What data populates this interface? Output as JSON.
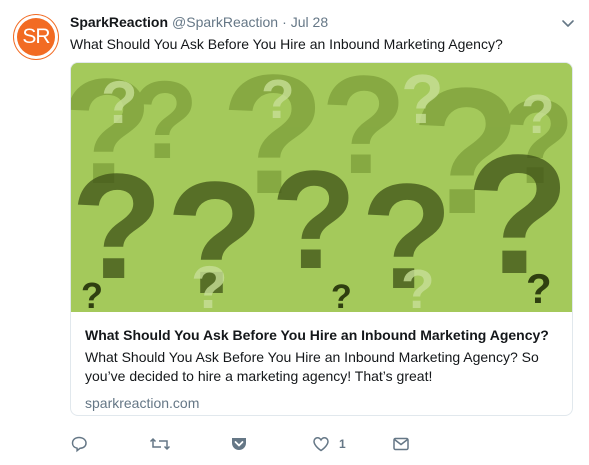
{
  "avatar": {
    "initials": "SR",
    "color": "#f26b23"
  },
  "author": {
    "name": "SparkReaction",
    "handle": "@SparkReaction",
    "separator": "·",
    "date": "Jul 28"
  },
  "tweet": {
    "text": "What Should You Ask Before You Hire an Inbound Marketing Agency?"
  },
  "card": {
    "image_description_icon": "question-marks-pattern",
    "title": "What Should You Ask Before You Hire an Inbound Marketing Agency?",
    "description": "What Should You Ask Before You Hire an Inbound Marketing Agency? So\nyou’ve decided to hire a marketing agency! That’s great!",
    "domain": "sparkreaction.com",
    "image_color": "#a4c95b"
  },
  "actions": {
    "reply_icon": "reply-icon",
    "retweet_icon": "retweet-icon",
    "pocket_icon": "pocket-icon",
    "like_icon": "heart-icon",
    "like_count": "1",
    "message_icon": "envelope-icon"
  },
  "menu": {
    "icon": "chevron-down-icon"
  }
}
